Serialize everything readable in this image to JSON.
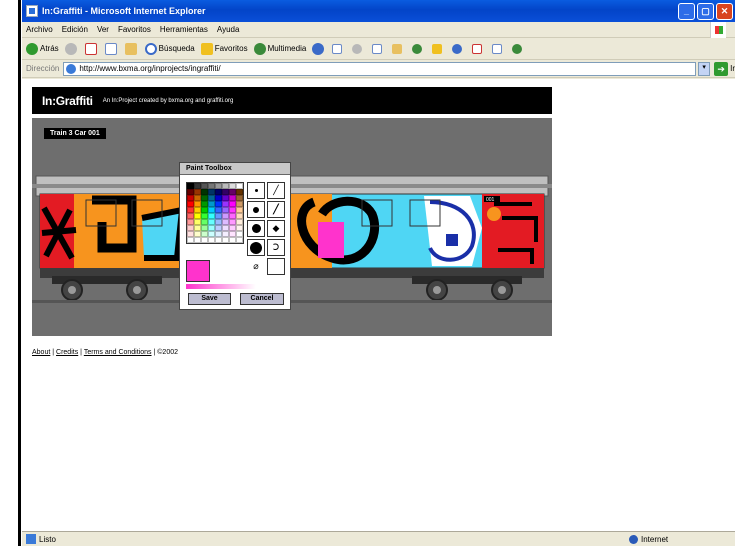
{
  "window": {
    "title": "In:Graffiti - Microsoft Internet Explorer",
    "controls": [
      "_",
      "▢",
      "✕"
    ]
  },
  "menu": [
    "Archivo",
    "Edición",
    "Ver",
    "Favoritos",
    "Herramientas",
    "Ayuda"
  ],
  "toolbar": {
    "back_label": "Atrás",
    "search_label": "Búsqueda",
    "favorites_label": "Favoritos",
    "multimedia_label": "Multimedia"
  },
  "address": {
    "label": "Dirección",
    "url": "http://www.bxma.org/inprojects/ingraffiti/",
    "go_label": "Ir"
  },
  "page": {
    "site_title": "In:Graffiti",
    "site_subtitle": "An In:Project created by bxma.org and graffiti.org",
    "car_label": "Train 3  Car 001",
    "car_number": "001"
  },
  "toolbox": {
    "title": "Paint Toolbox",
    "save_label": "Save",
    "cancel_label": "Cancel",
    "current_color": "#ff33cc",
    "palette": [
      "#000000",
      "#333333",
      "#555555",
      "#777777",
      "#999999",
      "#bbbbbb",
      "#dddddd",
      "#ffffff",
      "#660000",
      "#993300",
      "#003300",
      "#003366",
      "#000066",
      "#330066",
      "#660066",
      "#663300",
      "#cc0000",
      "#cc6600",
      "#006600",
      "#006699",
      "#0000cc",
      "#6600cc",
      "#cc00cc",
      "#996633",
      "#ff0000",
      "#ff9900",
      "#009900",
      "#0099cc",
      "#0033ff",
      "#9933ff",
      "#ff00ff",
      "#cc9966",
      "#ff3333",
      "#ffcc00",
      "#00cc00",
      "#00ccff",
      "#3366ff",
      "#9966ff",
      "#ff33ff",
      "#ffcc99",
      "#ff6666",
      "#ffff00",
      "#33ff33",
      "#33ffff",
      "#6699ff",
      "#cc99ff",
      "#ff66ff",
      "#ffddbb",
      "#ff9999",
      "#ffff66",
      "#66ff66",
      "#66ffff",
      "#99bbff",
      "#ddbbff",
      "#ff99ff",
      "#ffeedd",
      "#ffcccc",
      "#ffff99",
      "#99ff99",
      "#99ffff",
      "#bbccff",
      "#eeddff",
      "#ffccff",
      "#fff4ee",
      "#ffe0e0",
      "#ffffcc",
      "#ccffcc",
      "#ccffff",
      "#ddeeff",
      "#f4eeff",
      "#ffe4ff",
      "#ffffff",
      "#ffffff",
      "#ffffff",
      "#ffffff",
      "#ffffff",
      "#ffffff",
      "#ffffff",
      "#ffffff",
      "#ffffff"
    ]
  },
  "footer": {
    "about": "About",
    "credits": "Credits",
    "terms": "Terms and Conditions",
    "copyright": "©2002",
    "sep": "|"
  },
  "status": {
    "text": "Listo",
    "zone": "Internet"
  }
}
